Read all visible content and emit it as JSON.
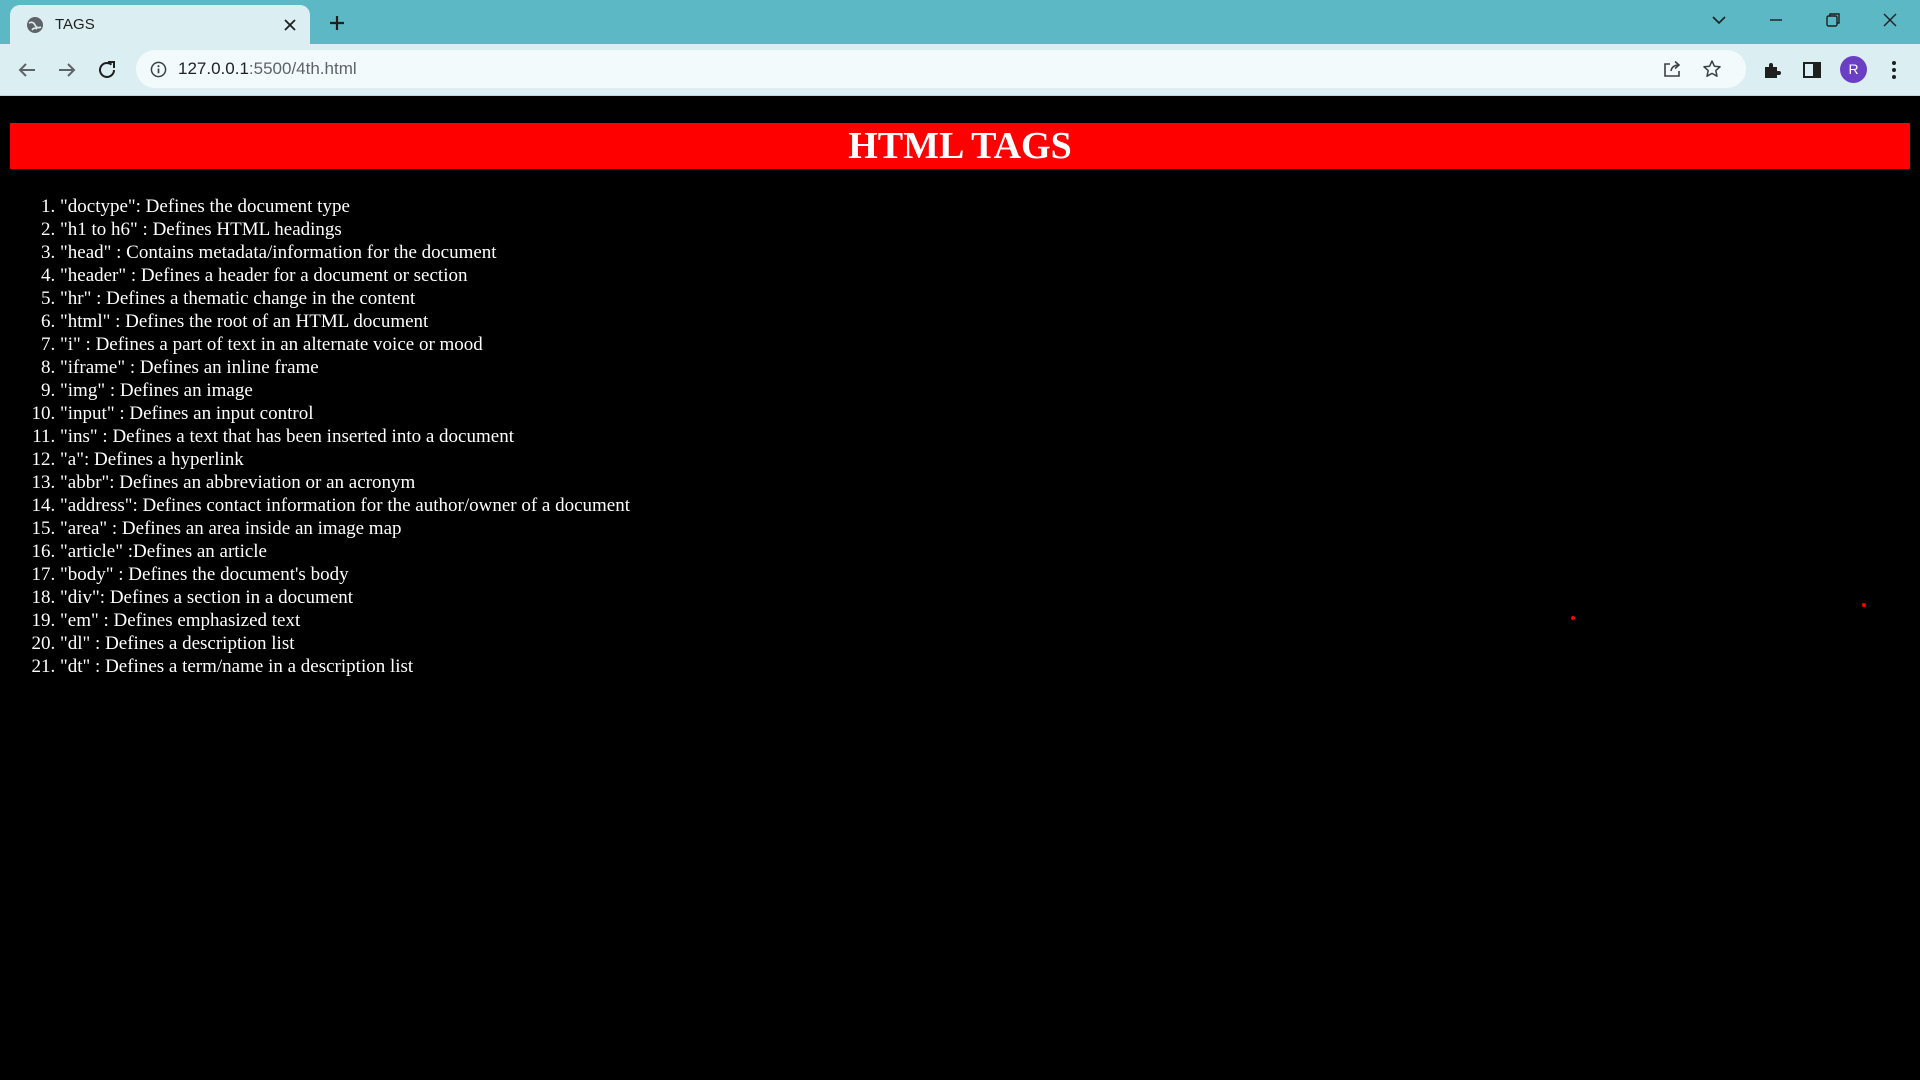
{
  "browser": {
    "tab_title": "TAGS",
    "url_host": "127.0.0.1",
    "url_path": ":5500/4th.html",
    "avatar_letter": "R"
  },
  "page": {
    "heading": "HTML TAGS",
    "items": [
      "\"doctype\": Defines the document type",
      "\"h1 to h6\" : Defines HTML headings",
      "\"head\" : Contains metadata/information for the document",
      "\"header\" : Defines a header for a document or section",
      "\"hr\" : Defines a thematic change in the content",
      "\"html\" : Defines the root of an HTML document",
      "\"i\" : Defines a part of text in an alternate voice or mood",
      "\"iframe\" : Defines an inline frame",
      "\"img\" : Defines an image",
      "\"input\" : Defines an input control",
      "\"ins\" : Defines a text that has been inserted into a document",
      "\"a\": Defines a hyperlink",
      "\"abbr\": Defines an abbreviation or an acronym",
      "\"address\": Defines contact information for the author/owner of a document",
      "\"area\" : Defines an area inside an image map",
      "\"article\" :Defines an article",
      "\"body\" : Defines the document's body",
      "\"div\": Defines a section in a document",
      "\"em\" : Defines emphasized text",
      "\"dl\" : Defines a description list",
      "\"dt\" : Defines a term/name in a description list"
    ]
  },
  "colors": {
    "tabstrip": "#5cb8c4",
    "toolbar": "#dbeff2",
    "heading_bg": "#ff0000",
    "page_bg": "#000000",
    "text": "#ffffff"
  }
}
